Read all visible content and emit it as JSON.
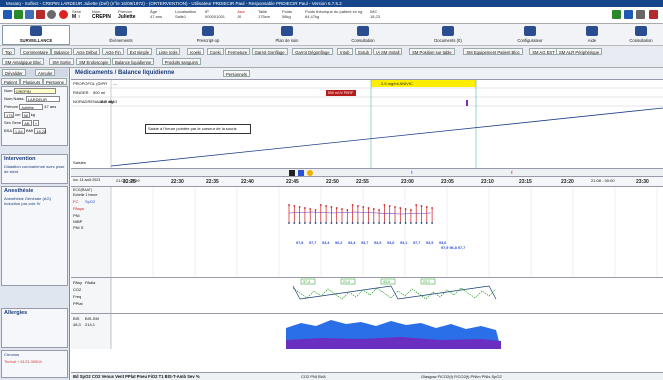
{
  "titlebar": {
    "text": "Mosaïq - Soflect - CREPIN LARDEUR Juliette (Def) (n°le 16/09/1972) - (ORTERVENTION) - Utilisateur PRDIECIR Paul - Responsable PRDIECIR Paul - Version 6.7.5.2"
  },
  "patient": {
    "sex_label": "Sexe",
    "sex": "M ♀",
    "name_label": "Nom",
    "name": "CREPIN",
    "first_label": "Prénom",
    "first": "Juliette",
    "age_label": "Âge",
    "age": "47 ans",
    "loc_label": "Localisation",
    "loc": "Salle1",
    "ip_label": "IP",
    "ip": "000001001",
    "jour_label": "Jour",
    "jour": "J0",
    "taille_label": "Taille",
    "taille": "175cm",
    "poids_label": "Poids",
    "poids": "58kg",
    "pth_label": "Poids théorique du patient en kg",
    "pth": "64,47kg",
    "imc_label": "IMC",
    "imc": "18,23"
  },
  "mainnav": [
    "SURVEILLANCE",
    "Évènements",
    "Prescript-op",
    "Plan de soin",
    "Consultation",
    "Documents (0)",
    "Configurateur",
    "Aide",
    "Consultation"
  ],
  "subnav": {
    "row1": [
      "Top",
      "Commentaire",
      "Balance",
      "Acte Début",
      "Acte Fin",
      "Ext simple",
      "Liste Icols",
      "Icoeki",
      "Coeki",
      "Fermeture",
      "Garrot Gonflage",
      "Garrot Dégonflage",
      "Intub",
      "Extub",
      "IA SM Install",
      "SM Position sur table",
      "SM Equipement Patient Bloc",
      "SM AG EST",
      "SM ALR Périphérique"
    ],
    "row2": [
      "SM Antalgique Bloc",
      "SM Sortie",
      "SM Endoscopie",
      "Balance liquidienne",
      "Produits sanguins"
    ]
  },
  "left": {
    "tabs": [
      "Dévalider",
      "Annuler"
    ],
    "subtabs": [
      "Patient",
      "Plusieurs",
      "Personne"
    ],
    "nom_label": "Nom",
    "nom": "CREPIN",
    "naiss_label": "Nom Naiss.",
    "naiss": "LARDEUR",
    "prenom_label": "Prénom",
    "prenom": "Juliette",
    "age": "47 ans",
    "taille": "175",
    "poids": "56",
    "unit_cm": "cm",
    "unit_kg": "kg",
    "sex_row": "Sex Sexe",
    "abo": "AB",
    "rh": "+",
    "bsa_label": "BSA",
    "bsa": "1,84",
    "bmi_label": "BMI",
    "bmi": "18,28",
    "intervention_title": "Intervention",
    "intervention_text": "Dilatation coronarienne avec pose de stent",
    "anesthesie_title": "Anesthésie",
    "anesthesie_text": "Anesthésie Générale (AG) Induction par voie IV",
    "allergies_title": "Allergies",
    "chronos_title": "Chronos",
    "chronos_text": "Timbal + 8123-39504"
  },
  "med": {
    "tabs": [
      "Médicaments / Balance liquidienne",
      "Personnels"
    ],
    "rows": [
      {
        "label": "PROPOFOL (DIPR",
        "val": "---"
      },
      {
        "label": "RINGER",
        "val": "500 ml"
      },
      {
        "label": "NORADRENALINE 8MG",
        "val": "16,0 mg"
      }
    ],
    "banner": "2,5 mg/ml ANIVIC",
    "redtag": "500 ml IV PERF",
    "tooltip": "Saisie à l'heure pointée par le curseur de la souris",
    "row_bottom": "Saisies"
  },
  "timeline": {
    "date_label": "lun. 14 août 2023",
    "start": "21:08 - 23:59",
    "right_range": "21:08 - 00:00",
    "ticks": [
      "22:25",
      "22:30",
      "22:35",
      "22:40",
      "22:45",
      "22:50",
      "22:55",
      "23:00",
      "23:05",
      "23:10",
      "23:15",
      "23:20",
      "23:30"
    ]
  },
  "graph1": {
    "labels": [
      "ECG(RAAT)",
      "Echelle 1 heure",
      "FC",
      "SpO2",
      "PAsys",
      "PNI",
      "NIBP",
      "PNI S"
    ],
    "values_row": [
      "97,8",
      "97,7",
      "93,4",
      "96,2",
      "93,4",
      "93,7",
      "93,9",
      "93,6",
      "93,1",
      "97,7",
      "93,9",
      "93,6"
    ],
    "values_row2": "97,9 96,8  97,7"
  },
  "graph2": {
    "labels": [
      "PAsy",
      "PAdia",
      "CO2",
      "Freq",
      "PPlat"
    ],
    "tags": [
      "37,4",
      "21,4",
      "43,0",
      "23,1"
    ]
  },
  "graph3": {
    "labels": [
      "BIS",
      "BIS-SM"
    ],
    "values": [
      "48,3",
      "214,1"
    ]
  },
  "footer": {
    "text": "Bd SpO2  CO2 Venus Vent PPlat Pneu FiO2 T1  BIS-T-Amb Sev %",
    "mid": "CO2  PNI  BVA",
    "right": "Glasgow  FiCO2(t) FiCO2(t) PNIm PNIs SpO2"
  },
  "colors": {
    "title": "#15458a",
    "nav": "#2a4d8f",
    "accent": "#ffee00",
    "red": "#cc1a1a",
    "green": "#1e9a1e",
    "blue": "#2b4fd8",
    "purple": "#7a2fb0"
  }
}
